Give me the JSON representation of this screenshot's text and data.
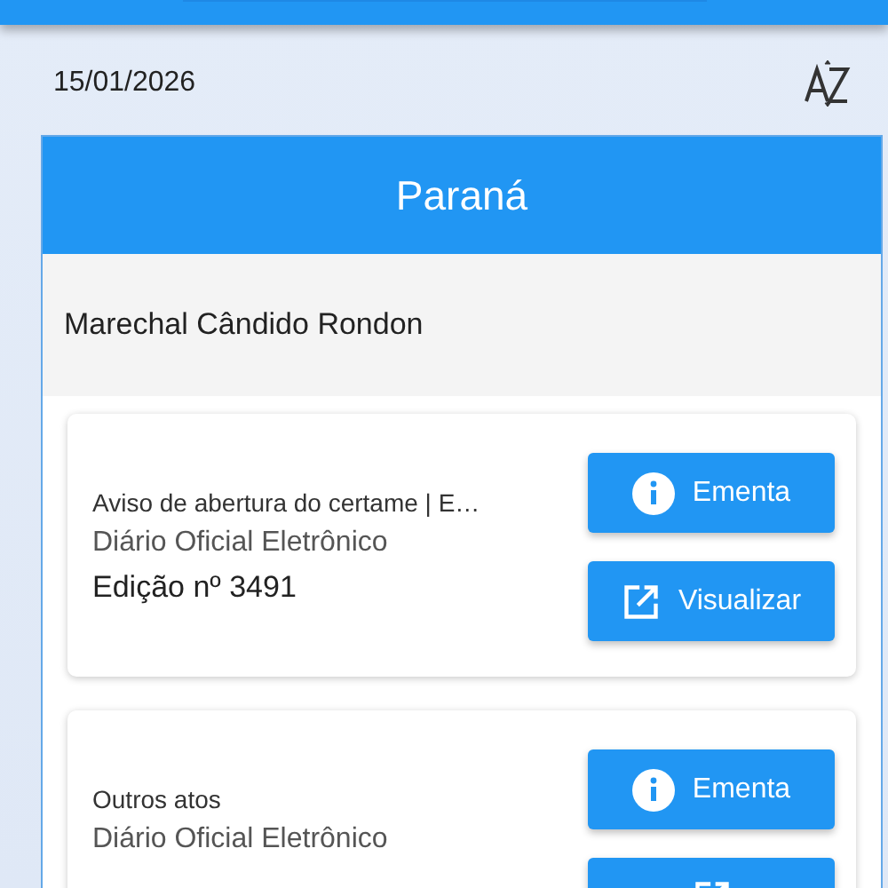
{
  "date": "15/01/2026",
  "state": "Paraná",
  "city": "Marechal Cândido Rondon",
  "items": [
    {
      "title": "Aviso de abertura do certame | E…",
      "source": "Diário Oficial Eletrônico",
      "edition": "Edição nº 3491",
      "buttons": [
        {
          "kind": "info",
          "label": "Ementa"
        },
        {
          "kind": "open",
          "label": "Visualizar"
        }
      ]
    },
    {
      "title": "Outros atos",
      "source": "Diário Oficial Eletrônico",
      "buttons": [
        {
          "kind": "info",
          "label": "Ementa"
        },
        {
          "kind": "open"
        }
      ]
    }
  ]
}
